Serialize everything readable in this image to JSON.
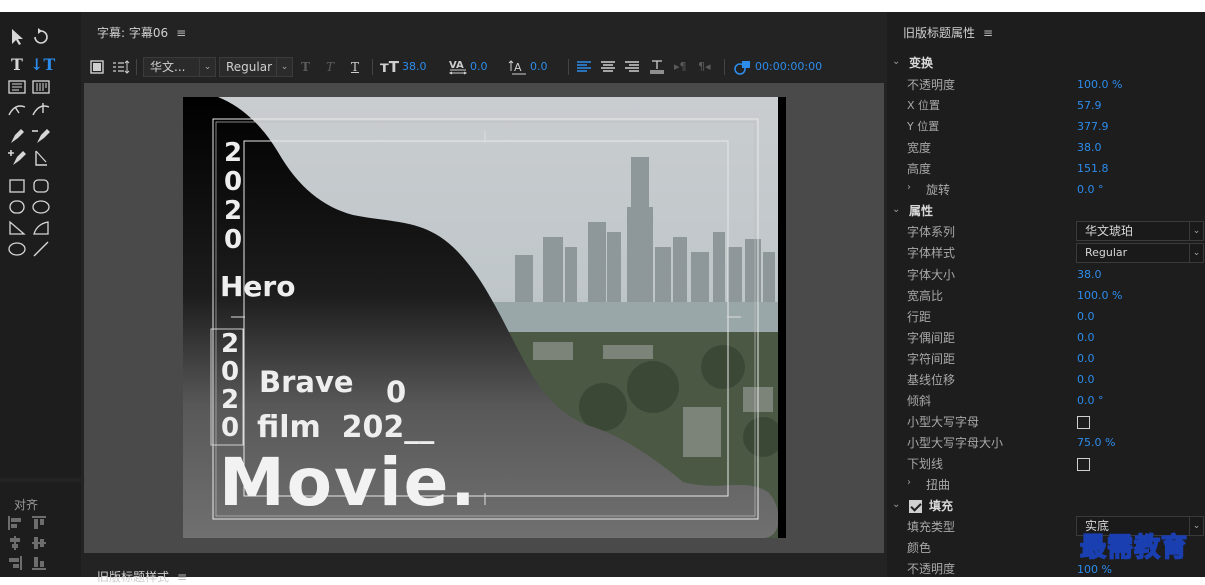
{
  "center_panel": {
    "title": "字幕: 字幕06",
    "menu_glyph": "≡"
  },
  "toolbar": {
    "font_family": "华文...",
    "font_style": "Regular",
    "font_size": "38.0",
    "kerning": "0.0",
    "baseline_shift": "0.0",
    "timecode": "00:00:00:00"
  },
  "canvas_text": {
    "vertical_year_top": [
      "2",
      "0",
      "2",
      "0"
    ],
    "hero": "Hero",
    "vertical_year_bottom": [
      "2",
      "0",
      "2",
      "0"
    ],
    "brave": "Brave",
    "zero": "0",
    "film": "film  202__",
    "movie": "Movie."
  },
  "align_panel": {
    "title": "对齐"
  },
  "bottom_panel": {
    "title": "旧版标题样式",
    "menu_glyph": "≡"
  },
  "right_panel": {
    "title": "旧版标题属性",
    "menu_glyph": "≡",
    "transform": {
      "section_label": "变换",
      "opacity_label": "不透明度",
      "opacity": "100.0 %",
      "x_label": "X 位置",
      "x": "57.9",
      "y_label": "Y 位置",
      "y": "377.9",
      "width_label": "宽度",
      "width": "38.0",
      "height_label": "高度",
      "height": "151.8",
      "rotation_label": "旋转",
      "rotation": "0.0 °"
    },
    "properties": {
      "section_label": "属性",
      "font_family_label": "字体系列",
      "font_family": "华文琥珀",
      "font_style_label": "字体样式",
      "font_style": "Regular",
      "font_size_label": "字体大小",
      "font_size": "38.0",
      "aspect_label": "宽高比",
      "aspect": "100.0 %",
      "leading_label": "行距",
      "leading": "0.0",
      "kerning_label": "字偶间距",
      "kerning": "0.0",
      "tracking_label": "字符间距",
      "tracking": "0.0",
      "baseline_label": "基线位移",
      "baseline": "0.0",
      "slant_label": "倾斜",
      "slant": "0.0 °",
      "small_caps_label": "小型大写字母",
      "small_caps_size_label": "小型大写字母大小",
      "small_caps_size": "75.0 %",
      "underline_label": "下划线",
      "distort_label": "扭曲"
    },
    "fill": {
      "section_label": "填充",
      "fill_type_label": "填充类型",
      "fill_type": "实底",
      "color_label": "颜色",
      "opacity_label": "不透明度",
      "opacity": "100 %"
    }
  },
  "watermark": "最需教育",
  "colors": {
    "accent": "#2d8ceb",
    "panel": "#1d1d1d",
    "frame": "#232323",
    "canvas_bg": "#4a4a4a"
  }
}
